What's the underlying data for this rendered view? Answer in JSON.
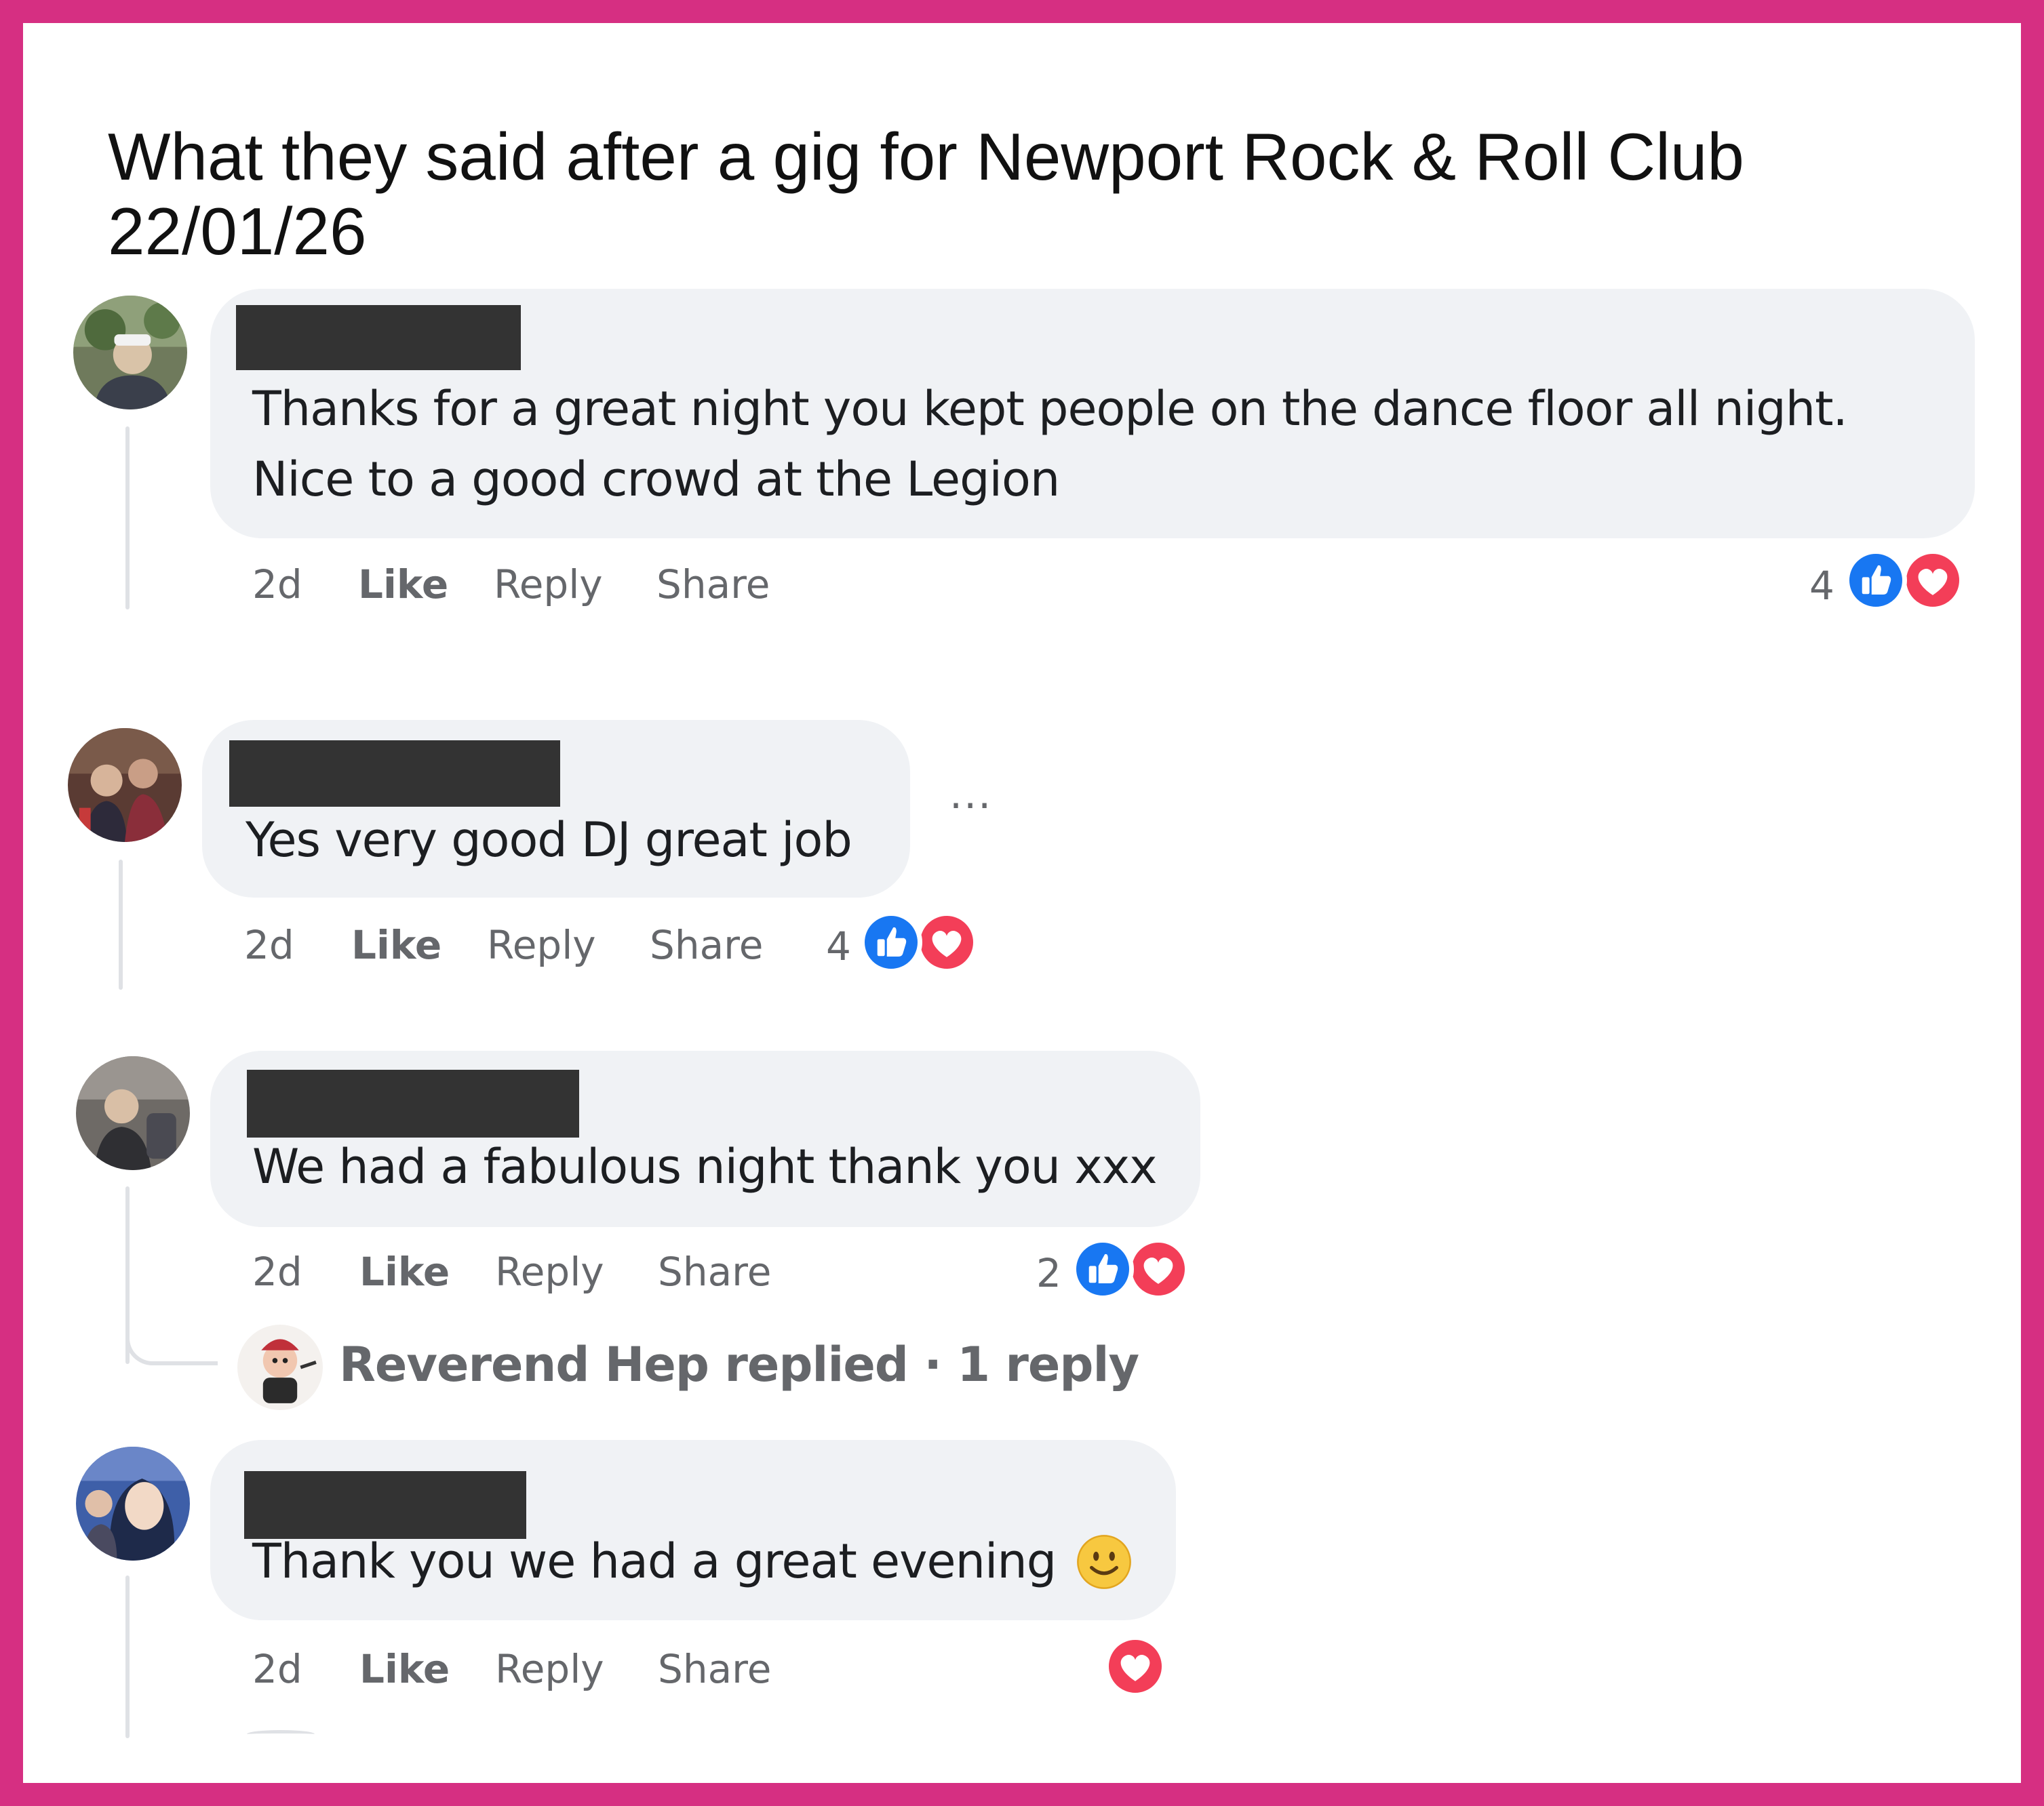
{
  "page_title": {
    "line1": "What they said after a gig for Newport Rock & Roll Club",
    "line2": "22/01/26"
  },
  "colors": {
    "border": "#d62f82",
    "bubble": "#f0f2f5",
    "like_blue": "#1877f2",
    "love_red": "#f33e58",
    "meta_grey": "#65676b",
    "redaction": "#333333"
  },
  "icons": {
    "like_reaction": "thumbs-up-icon",
    "love_reaction": "heart-icon",
    "more_options": "ellipsis-icon",
    "emoji": "slightly-smiling-face-emoji"
  },
  "comments": [
    {
      "text_line1": "Thanks for a great night you kept people on the dance floor all night.",
      "text_line2": "Nice to a good crowd at the Legion",
      "time": "2d",
      "like": "Like",
      "reply": "Reply",
      "share": "Share",
      "reaction_count": "4",
      "reactions": [
        "like",
        "love"
      ]
    },
    {
      "text": "Yes very good DJ great job",
      "more": "···",
      "time": "2d",
      "like": "Like",
      "reply": "Reply",
      "share": "Share",
      "reaction_count": "4",
      "reactions": [
        "like",
        "love"
      ]
    },
    {
      "text": "We had a fabulous night thank you xxx",
      "time": "2d",
      "like": "Like",
      "reply": "Reply",
      "share": "Share",
      "reaction_count": "2",
      "reactions": [
        "like",
        "love"
      ],
      "replies_summary": "Reverend Hep replied · 1 reply"
    },
    {
      "text": "Thank you we had a great evening",
      "time": "2d",
      "like": "Like",
      "reply": "Reply",
      "share": "Share",
      "reactions": [
        "love"
      ]
    }
  ]
}
